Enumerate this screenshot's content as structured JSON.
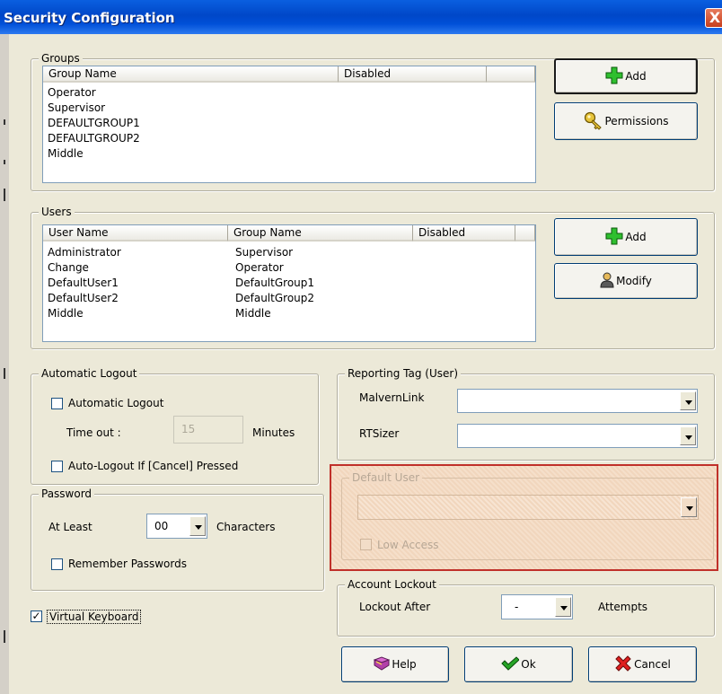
{
  "window": {
    "title": "Security Configuration",
    "close_glyph": "X"
  },
  "groups": {
    "legend": "Groups",
    "columns": [
      "Group Name",
      "Disabled"
    ],
    "rows": [
      [
        "Operator",
        ""
      ],
      [
        "Supervisor",
        ""
      ],
      [
        "DEFAULTGROUP1",
        ""
      ],
      [
        "DEFAULTGROUP2",
        ""
      ],
      [
        "Middle",
        ""
      ]
    ],
    "add_label": "Add",
    "permissions_label": "Permissions"
  },
  "users": {
    "legend": "Users",
    "columns": [
      "User Name",
      "Group Name",
      "Disabled"
    ],
    "rows": [
      [
        "Administrator",
        "Supervisor",
        ""
      ],
      [
        "Change",
        "Operator",
        ""
      ],
      [
        "DefaultUser1",
        "DefaultGroup1",
        ""
      ],
      [
        "DefaultUser2",
        "DefaultGroup2",
        ""
      ],
      [
        "Middle",
        "Middle",
        ""
      ]
    ],
    "add_label": "Add",
    "modify_label": "Modify"
  },
  "auto_logout": {
    "legend": "Automatic Logout",
    "checkbox_label": "Automatic Logout",
    "timeout_label": "Time out :",
    "timeout_value": "15",
    "minutes_label": "Minutes",
    "cancel_logout_label": "Auto-Logout If [Cancel] Pressed"
  },
  "password": {
    "legend": "Password",
    "at_least_label": "At Least",
    "length_value": "00",
    "characters_label": "Characters",
    "remember_label": "Remember Passwords"
  },
  "virtual_keyboard": {
    "label": "Virtual Keyboard",
    "checked_glyph": "✓"
  },
  "reporting_tag": {
    "legend": "Reporting Tag (User)",
    "malvern_label": "MalvernLink",
    "malvern_value": "",
    "rtsizer_label": "RTSizer",
    "rtsizer_value": ""
  },
  "default_user": {
    "legend": "Default User",
    "value": "",
    "low_access_label": "Low Access"
  },
  "account_lockout": {
    "legend": "Account Lockout",
    "lockout_label": "Lockout After",
    "value": "-",
    "attempts_label": "Attempts"
  },
  "footer": {
    "help_label": "Help",
    "ok_label": "Ok",
    "cancel_label": "Cancel"
  },
  "colors": {
    "highlight_border": "#c0302a",
    "title_bar": "#0054e3"
  }
}
